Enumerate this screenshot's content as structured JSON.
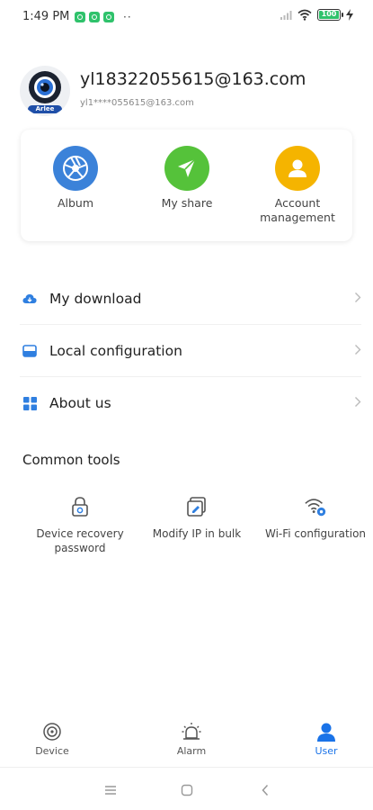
{
  "status": {
    "time": "1:49 PM",
    "dots": "··",
    "battery": "100"
  },
  "profile": {
    "name": "yl18322055615@163.com",
    "sub": "yl1****055615@163.com",
    "avatar_text": "Arlee"
  },
  "card": [
    {
      "label": "Album",
      "icon": "album-icon",
      "color": "#3b82d9"
    },
    {
      "label": "My share",
      "icon": "share-icon",
      "color": "#55c23a"
    },
    {
      "label": "Account\nmanagement",
      "icon": "account-icon",
      "color": "#f5b400"
    }
  ],
  "menu": [
    {
      "label": "My download",
      "icon": "cloud-download-icon"
    },
    {
      "label": "Local configuration",
      "icon": "folder-icon"
    },
    {
      "label": "About us",
      "icon": "grid-icon"
    }
  ],
  "tools": {
    "title": "Common tools",
    "items": [
      {
        "label": "Device recovery\npassword",
        "icon": "lock-icon"
      },
      {
        "label": "Modify IP in bulk",
        "icon": "edit-ip-icon"
      },
      {
        "label": "Wi-Fi configuration",
        "icon": "wifi-config-icon"
      }
    ]
  },
  "tabs": [
    {
      "label": "Device",
      "icon": "device-icon",
      "active": false
    },
    {
      "label": "Alarm",
      "icon": "alarm-icon",
      "active": false
    },
    {
      "label": "User",
      "icon": "user-icon",
      "active": true
    }
  ],
  "colors": {
    "accent": "#1a73e8",
    "menu_icon": "#2f7fe0"
  }
}
